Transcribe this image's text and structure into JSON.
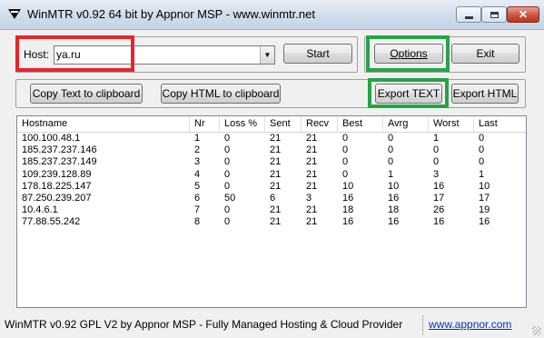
{
  "window": {
    "title": "WinMTR v0.92 64 bit by Appnor MSP - www.winmtr.net",
    "icon": "winmtr-app-icon",
    "controls": [
      "minimize-icon",
      "maximize-icon",
      "close-icon"
    ],
    "close_color": "#c94f39"
  },
  "host": {
    "label": "Host:",
    "value": "ya.ru"
  },
  "buttons": {
    "start": "Start",
    "options": "Options",
    "exit": "Exit",
    "copy_text": "Copy Text to clipboard",
    "copy_html": "Copy HTML to clipboard",
    "export_text": "Export TEXT",
    "export_html": "Export HTML"
  },
  "highlights": {
    "red": "#e8242a",
    "green": "#24a545"
  },
  "table": {
    "columns": [
      "Hostname",
      "Nr",
      "Loss %",
      "Sent",
      "Recv",
      "Best",
      "Avrg",
      "Worst",
      "Last"
    ],
    "rows": [
      [
        "100.100.48.1",
        "1",
        "0",
        "21",
        "21",
        "0",
        "0",
        "1",
        "0"
      ],
      [
        "185.237.237.146",
        "2",
        "0",
        "21",
        "21",
        "0",
        "0",
        "0",
        "0"
      ],
      [
        "185.237.237.149",
        "3",
        "0",
        "21",
        "21",
        "0",
        "0",
        "0",
        "0"
      ],
      [
        "109.239.128.89",
        "4",
        "0",
        "21",
        "21",
        "0",
        "1",
        "3",
        "1"
      ],
      [
        "178.18.225.147",
        "5",
        "0",
        "21",
        "21",
        "10",
        "10",
        "16",
        "10"
      ],
      [
        "87.250.239.207",
        "6",
        "50",
        "6",
        "3",
        "16",
        "16",
        "17",
        "17"
      ],
      [
        "10.4.6.1",
        "7",
        "0",
        "21",
        "21",
        "18",
        "18",
        "26",
        "19"
      ],
      [
        "77.88.55.242",
        "8",
        "0",
        "21",
        "21",
        "16",
        "16",
        "16",
        "16"
      ]
    ]
  },
  "status": {
    "text": "WinMTR v0.92 GPL V2 by Appnor MSP - Fully Managed Hosting & Cloud Provider",
    "link": "www.appnor.com",
    "link_color": "#0033cc"
  }
}
